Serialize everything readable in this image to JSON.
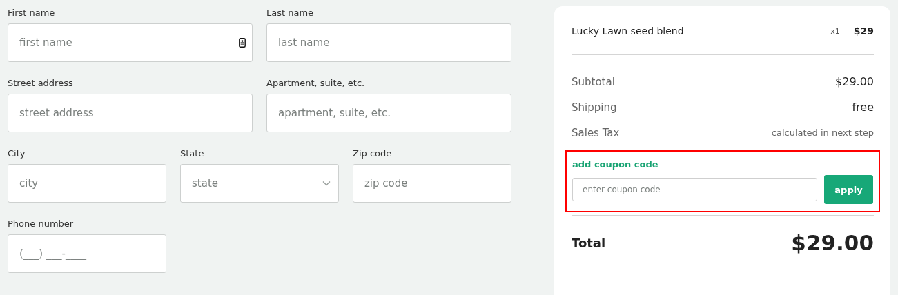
{
  "form": {
    "rows": [
      {
        "fields": [
          {
            "label": "First name",
            "placeholder": "first name",
            "kind": "text",
            "autofill_icon": true
          },
          {
            "label": "Last name",
            "placeholder": "last name",
            "kind": "text",
            "autofill_icon": false
          }
        ]
      },
      {
        "fields": [
          {
            "label": "Street address",
            "placeholder": "street address",
            "kind": "text",
            "autofill_icon": false
          },
          {
            "label": "Apartment, suite, etc.",
            "placeholder": "apartment, suite, etc.",
            "kind": "text",
            "autofill_icon": false
          }
        ]
      },
      {
        "fields": [
          {
            "label": "City",
            "placeholder": "city",
            "kind": "text",
            "autofill_icon": false
          },
          {
            "label": "State",
            "placeholder": "state",
            "kind": "select",
            "autofill_icon": false
          },
          {
            "label": "Zip code",
            "placeholder": "zip code",
            "kind": "text",
            "autofill_icon": false
          }
        ]
      },
      {
        "fields": [
          {
            "label": "Phone number",
            "placeholder": "(___) ___-____",
            "kind": "text",
            "autofill_icon": false
          },
          {
            "kind": "spacer"
          },
          {
            "kind": "spacer"
          }
        ]
      }
    ]
  },
  "summary": {
    "items": [
      {
        "name": "Lucky Lawn seed blend",
        "quantity": "x1",
        "price": "$29"
      }
    ],
    "lines": [
      {
        "label": "Subtotal",
        "value": "$29.00",
        "kind": "strong"
      },
      {
        "label": "Shipping",
        "value": "free",
        "kind": "strong"
      },
      {
        "label": "Sales Tax",
        "value": "calculated in next step",
        "kind": "note"
      }
    ],
    "coupon": {
      "link": "add coupon code",
      "placeholder": "enter coupon code",
      "button": "apply",
      "highlighted": true
    },
    "total": {
      "label": "Total",
      "value": "$29.00"
    }
  }
}
